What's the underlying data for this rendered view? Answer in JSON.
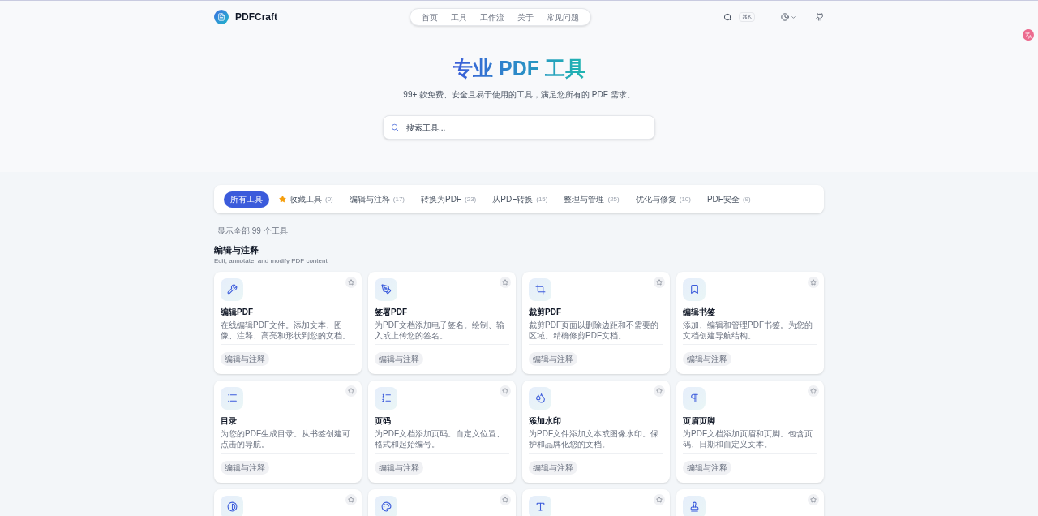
{
  "header": {
    "logo": "PDFCraft",
    "nav": [
      {
        "label": "首页",
        "selected": false
      },
      {
        "label": "工具",
        "selected": false
      },
      {
        "label": "工作流",
        "selected": false
      },
      {
        "label": "关于",
        "selected": false
      },
      {
        "label": "常见问题",
        "selected": false
      }
    ],
    "shortcut": "⌘K"
  },
  "hero": {
    "title": "专业 PDF 工具",
    "subtitle": "99+ 款免费、安全且易于使用的工具，满足您所有的 PDF 需求。",
    "search": {
      "placeholder": "搜索工具..."
    }
  },
  "filters": [
    {
      "label": "所有工具",
      "selected": true,
      "kind": "plain"
    },
    {
      "label": "收藏工具",
      "count": "(0)",
      "selected": false,
      "kind": "star"
    },
    {
      "label": "编辑与注释",
      "count": "(17)",
      "selected": false,
      "kind": "plain"
    },
    {
      "label": "转换为PDF",
      "count": "(23)",
      "selected": false,
      "kind": "plain"
    },
    {
      "label": "从PDF转换",
      "count": "(15)",
      "selected": false,
      "kind": "plain"
    },
    {
      "label": "整理与管理",
      "count": "(25)",
      "selected": false,
      "kind": "plain"
    },
    {
      "label": "优化与修复",
      "count": "(10)",
      "selected": false,
      "kind": "plain"
    },
    {
      "label": "PDF安全",
      "count": "(9)",
      "selected": false,
      "kind": "plain"
    }
  ],
  "result_count": "显示全部 99 个工具",
  "section": {
    "title": "编辑与注释",
    "subtitle": "Edit, annotate, and modify PDF content"
  },
  "tools": [
    {
      "kind": "full",
      "title": "编辑PDF",
      "description": "在线编辑PDF文件。添加文本、图像、注释、高亮和形状到您的文档。",
      "tag": "编辑与注释"
    },
    {
      "kind": "full",
      "title": "签署PDF",
      "description": "为PDF文档添加电子签名。绘制、输入或上传您的签名。",
      "tag": "编辑与注释"
    },
    {
      "kind": "full",
      "title": "裁剪PDF",
      "description": "裁剪PDF页面以删除边距和不需要的区域。精确修剪PDF文档。",
      "tag": "编辑与注释"
    },
    {
      "kind": "full",
      "title": "编辑书签",
      "description": "添加、编辑和管理PDF书签。为您的文档创建导航结构。",
      "tag": "编辑与注释"
    },
    {
      "kind": "full",
      "title": "目录",
      "description": "为您的PDF生成目录。从书签创建可点击的导航。",
      "tag": "编辑与注释"
    },
    {
      "kind": "full",
      "title": "页码",
      "description": "为PDF文档添加页码。自定义位置、格式和起始编号。",
      "tag": "编辑与注释"
    },
    {
      "kind": "full",
      "title": "添加水印",
      "description": "为PDF文件添加文本或图像水印。保护和品牌化您的文档。",
      "tag": "编辑与注释"
    },
    {
      "kind": "full",
      "title": "页眉页脚",
      "description": "为PDF文档添加页眉和页脚。包含页码、日期和自定义文本。",
      "tag": "编辑与注释"
    },
    {
      "kind": "partial"
    },
    {
      "kind": "partial"
    },
    {
      "kind": "partial"
    },
    {
      "kind": "partial"
    }
  ]
}
